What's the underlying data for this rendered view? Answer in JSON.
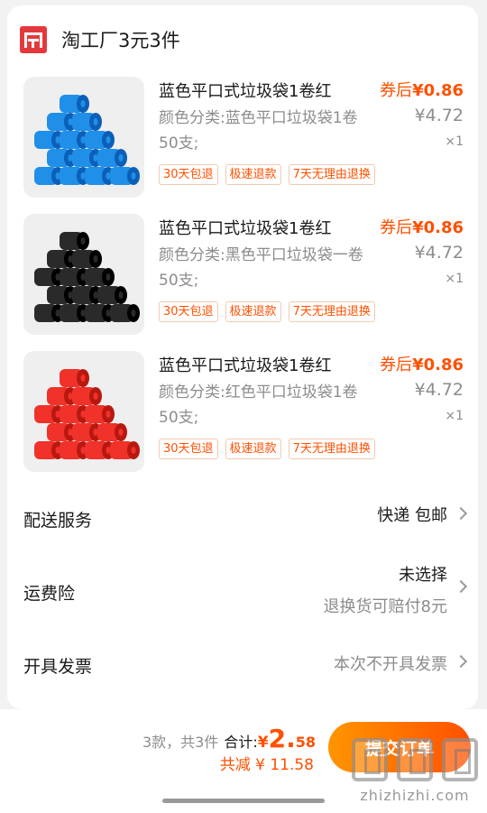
{
  "shop": {
    "name": "淘工厂3元3件",
    "brand_color": "#e4393c"
  },
  "items": [
    {
      "title": "蓝色平口式垃圾袋1卷红",
      "sku": "颜色分类:蓝色平口垃圾袋1卷50支;",
      "coupon_label": "券后",
      "coupon_price": "¥0.86",
      "orig_price": "¥4.72",
      "qty": "×1",
      "tags": [
        "30天包退",
        "极速退款",
        "7天无理由退换"
      ],
      "product_color": "#1f8fe8",
      "product_color_dark": "#0c5fb8"
    },
    {
      "title": "蓝色平口式垃圾袋1卷红",
      "sku": "颜色分类:黑色平口垃圾袋一卷50支;",
      "coupon_label": "券后",
      "coupon_price": "¥0.86",
      "orig_price": "¥4.72",
      "qty": "×1",
      "tags": [
        "30天包退",
        "极速退款",
        "7天无理由退换"
      ],
      "product_color": "#2a2a2a",
      "product_color_dark": "#000000"
    },
    {
      "title": "蓝色平口式垃圾袋1卷红",
      "sku": "颜色分类:红色平口垃圾袋1卷50支;",
      "coupon_label": "券后",
      "coupon_price": "¥0.86",
      "orig_price": "¥4.72",
      "qty": "×1",
      "tags": [
        "30天包退",
        "极速退款",
        "7天无理由退换"
      ],
      "product_color": "#f0322a",
      "product_color_dark": "#b81810"
    }
  ],
  "delivery": {
    "label": "配送服务",
    "value": "快递 包邮"
  },
  "shipping_insurance": {
    "label": "运费险",
    "value": "未选择",
    "sub": "退换货可赔付8元"
  },
  "invoice": {
    "label": "开具发票",
    "value": "本次不开具发票"
  },
  "summary": {
    "count_text": "3款，共3件",
    "total_label": "合计:",
    "currency": "¥",
    "total_int": "2.",
    "total_dec": "58",
    "discount_text": "共减 ¥ 11.58",
    "submit_label": "提交订单"
  },
  "watermark": {
    "text": "zhizhizhi.com"
  },
  "colors": {
    "accent": "#ff5000",
    "grey_text": "#8c8c8c",
    "button_gradient_start": "#ff9500"
  }
}
